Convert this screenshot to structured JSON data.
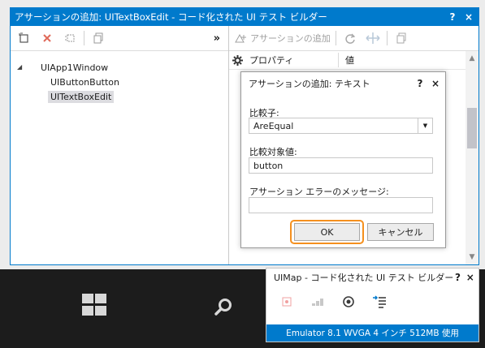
{
  "main_window": {
    "title": "アサーションの追加: UITextBoxEdit - コード化された UI テスト ビルダー",
    "help": "?",
    "close": "×"
  },
  "left_toolbar": {
    "more": "»",
    "icons": [
      "new-window-icon",
      "delete-icon",
      "split-icon",
      "copy-icon"
    ]
  },
  "tree": {
    "root": "UIApp1Window",
    "children": [
      "UIButtonButton",
      "UITextBoxEdit"
    ],
    "selected": "UITextBoxEdit"
  },
  "right_toolbar": {
    "add_assertion": "アサーションの追加",
    "icons": [
      "add-assertion-icon",
      "refresh-icon",
      "move-icon",
      "copy-icon"
    ]
  },
  "properties": {
    "col_property": "プロパティ",
    "col_value": "値"
  },
  "dialog": {
    "title": "アサーションの追加: テキスト",
    "help": "?",
    "close": "×",
    "comparator_label": "比較子:",
    "comparator_value": "AreEqual",
    "compare_value_label": "比較対象値:",
    "compare_value": "button",
    "error_label": "アサーション エラーのメッセージ:",
    "error_value": "",
    "ok": "OK",
    "cancel": "キャンセル"
  },
  "uimap_window": {
    "title": "UIMap - コード化された UI テスト ビルダー",
    "help": "?",
    "close": "×",
    "icons": [
      "record-icon",
      "steps-icon",
      "target-icon",
      "generate-code-icon"
    ]
  },
  "status": {
    "text": "Emulator 8.1 WVGA 4 インチ 512MB 使用"
  },
  "colors": {
    "accent": "#007acc",
    "focus_ring": "#f5901e",
    "selection": "#dcdce0"
  }
}
